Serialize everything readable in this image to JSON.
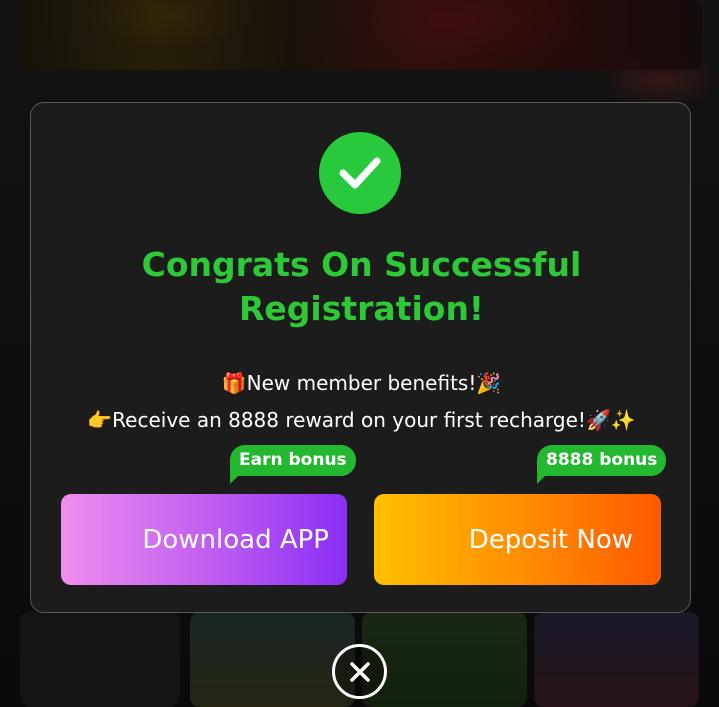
{
  "modal": {
    "success_icon": "check-circle-icon",
    "title_line1": "Congrats On Successful",
    "title_line2": "Registration!",
    "benefits_line1": {
      "emoji_before": "🎁",
      "text": "New member benefits!",
      "emoji_after": "🎉"
    },
    "benefits_line2": {
      "emoji_before": "👉",
      "text": "Receive an 8888 reward on your first recharge!",
      "emoji_after": "🚀✨"
    },
    "download_button": {
      "label": "Download APP",
      "tag": "Earn bonus"
    },
    "deposit_button": {
      "label": "Deposit Now",
      "tag": "8888 bonus"
    },
    "close_icon": "close-circle-icon"
  },
  "colors": {
    "accent_green": "#2dc936",
    "tag_green": "#23b82f",
    "download_gradient": [
      "#f08ef0",
      "#8a2ef5"
    ],
    "deposit_gradient": [
      "#ffbf00",
      "#ff5a00"
    ],
    "modal_bg": "#1c1c1c"
  }
}
